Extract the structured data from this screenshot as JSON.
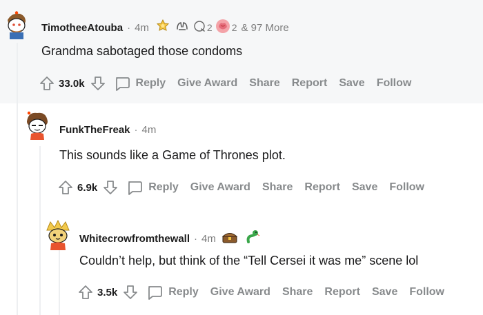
{
  "comments": [
    {
      "username": "TimotheeAtouba",
      "time": "4m",
      "award_count_1": "2",
      "award_count_2": "2",
      "more_awards": "& 97 More",
      "body": "Grandma sabotaged those condoms",
      "score": "33.0k",
      "avatar": "snoo-avatar-icon"
    },
    {
      "username": "FunkTheFreak",
      "time": "4m",
      "body": "This sounds like a Game of Thrones plot.",
      "score": "6.9k",
      "avatar": "snoo-avatar-icon"
    },
    {
      "username": "Whitecrowfromthewall",
      "time": "4m",
      "body": "Couldn’t help, but think of the “Tell Cersei it was me” scene lol",
      "score": "3.5k",
      "avatar": "snoo-avatar-icon"
    }
  ],
  "actions": {
    "reply": "Reply",
    "give_award": "Give Award",
    "share": "Share",
    "report": "Report",
    "save": "Save",
    "follow": "Follow"
  },
  "separator": "·",
  "colors": {
    "top_band": "#f6f7f8",
    "meta_gray": "#878a8c",
    "thread_line": "#edeff1"
  }
}
